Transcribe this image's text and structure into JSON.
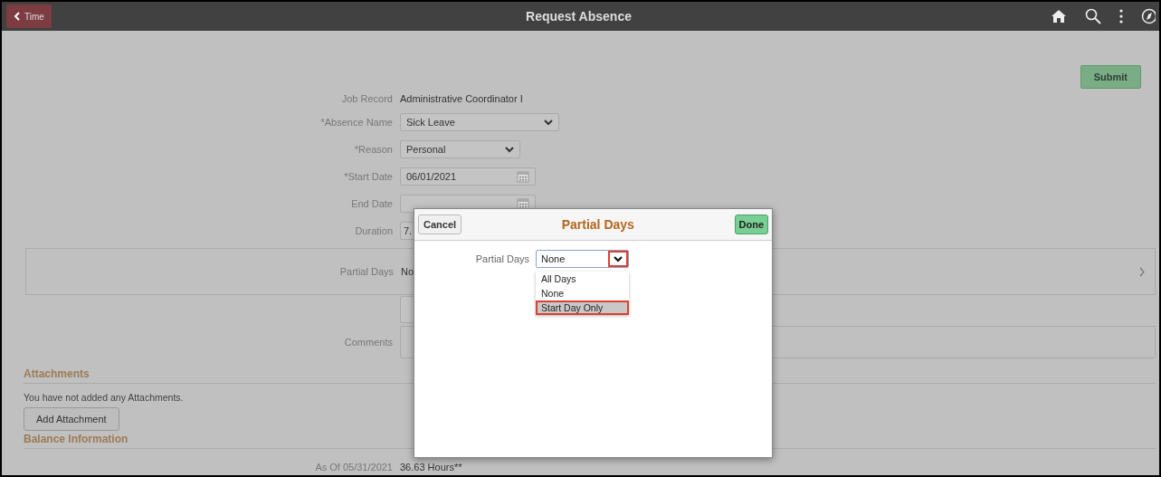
{
  "header": {
    "back": "Time",
    "title": "Request Absence"
  },
  "submit": "Submit",
  "form": [
    {
      "kind": "text",
      "label": "Job Record",
      "value": "Administrative Coordinator I"
    },
    {
      "kind": "select",
      "label": "*Absence Name",
      "value": "Sick Leave"
    },
    {
      "kind": "select",
      "label": "*Reason",
      "value": "Personal"
    },
    {
      "kind": "date",
      "label": "*Start Date",
      "value": "06/01/2021"
    },
    {
      "kind": "date",
      "label": "End Date"
    },
    {
      "kind": "input",
      "label": "Duration",
      "value": "7."
    }
  ],
  "partial_days": {
    "label": "Partial Days",
    "value": "No"
  },
  "comments": {
    "label": "Comments"
  },
  "attachments": {
    "title": "Attachments",
    "message": "You have not added any Attachments.",
    "button": "Add Attachment"
  },
  "balance": {
    "title": "Balance Information",
    "label": "As Of 05/31/2021",
    "value": "36.63 Hours**"
  },
  "modal": {
    "cancel": "Cancel",
    "title": "Partial Days",
    "done": "Done",
    "field_label": "Partial Days",
    "field_value": "None",
    "options": [
      {
        "label": "All Days",
        "selected": false
      },
      {
        "label": "None",
        "selected": false
      },
      {
        "label": "Start Day Only",
        "selected": true
      }
    ]
  }
}
